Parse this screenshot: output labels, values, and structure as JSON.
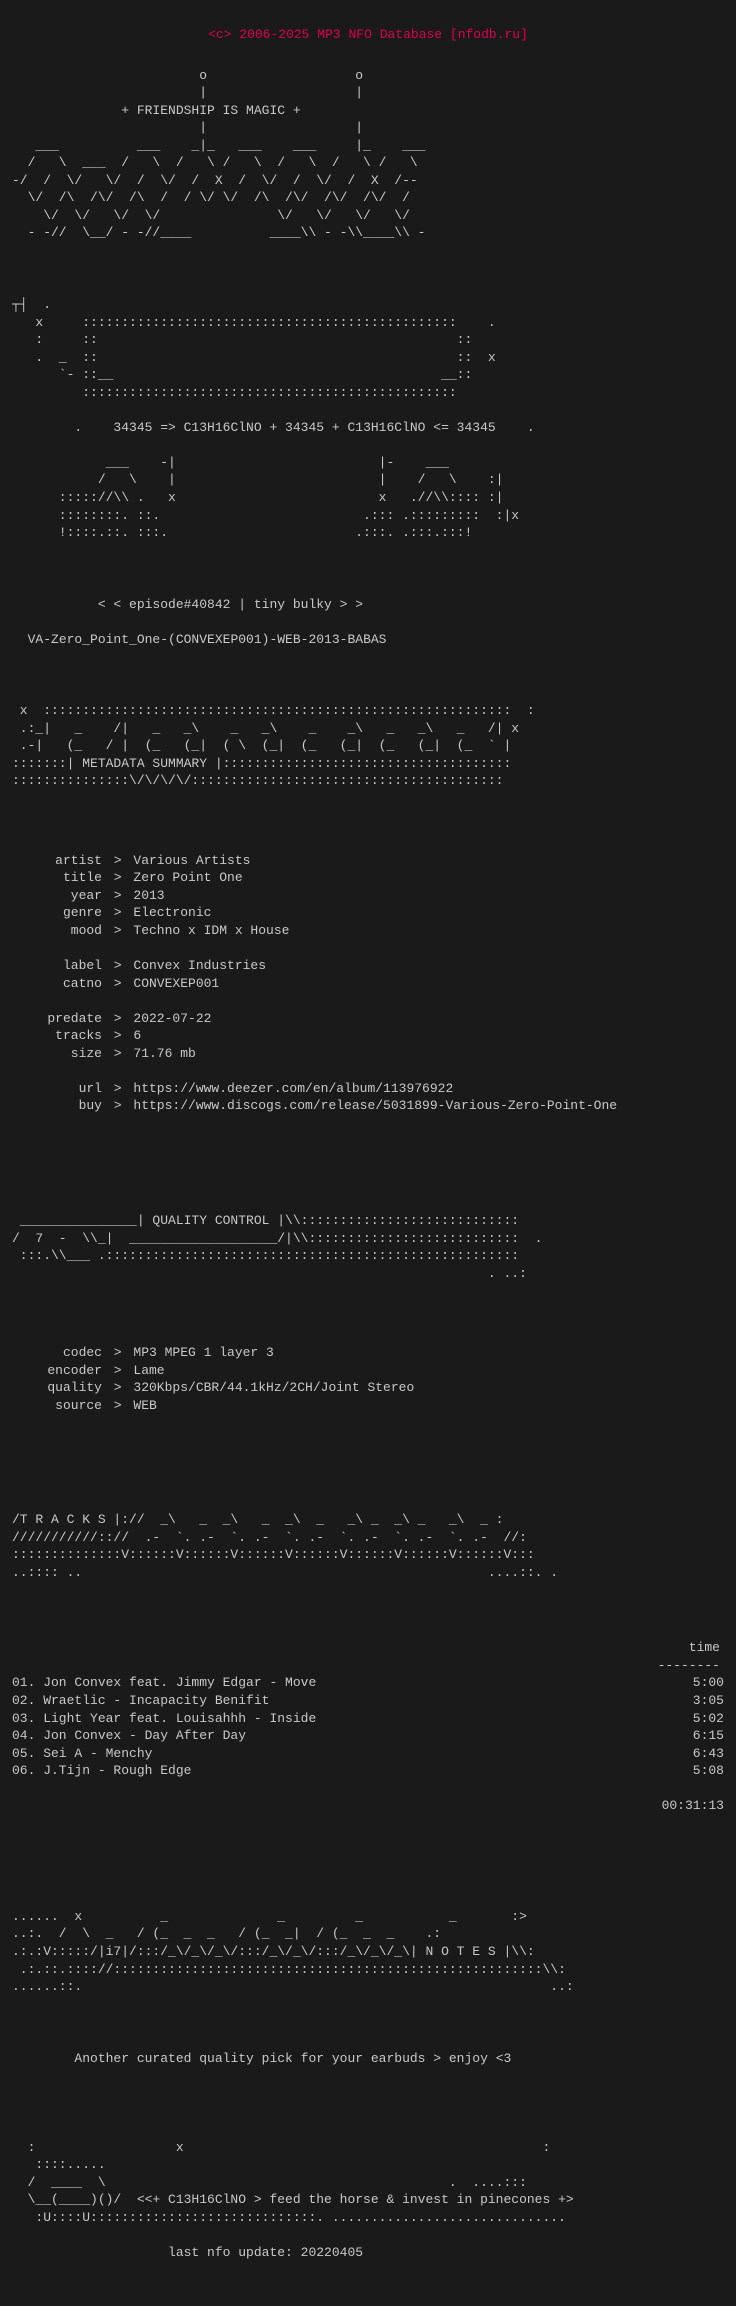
{
  "header": {
    "copyright": "<c> 2006-2025 MP3 NFO Database [nfodb.ru]"
  },
  "ascii_blocks": {
    "friendship": "+ FRIENDSHIP IS MAGIC +",
    "episode": "< episode#40842 | tiny bulky >",
    "release_name": "VA-Zero_Point_One-(CONVEXEP001)-WEB-2013-BABAS",
    "formula": "34345 => C13H16ClNO + 34345 + C13H16ClNO <= 34345"
  },
  "metadata": {
    "section_title": "METADATA SUMMARY",
    "artist": "Various Artists",
    "title": "Zero Point One",
    "year": "2013",
    "genre": "Electronic",
    "mood": "Techno x IDM x House",
    "label": "Convex Industries",
    "catno": "CONVEXEP001",
    "predate": "2022-07-22",
    "tracks": "6",
    "size": "71.76 mb",
    "url": "https://www.deezer.com/en/album/113976922",
    "buy": "https://www.discogs.com/release/5031899-Various-Zero-Point-One"
  },
  "quality": {
    "section_title": "QUALITY CONTROL",
    "codec": "MP3 MPEG 1 layer 3",
    "encoder": "Lame",
    "quality": "320Kbps/CBR/44.1kHz/2CH/Joint Stereo",
    "source": "WEB"
  },
  "tracks": {
    "section_title": "T R A C K S",
    "time_header": "time",
    "separator": "--------",
    "list": [
      {
        "number": "01.",
        "name": "Jon Convex feat. Jimmy Edgar - Move",
        "time": "5:00"
      },
      {
        "number": "02.",
        "name": "Wraetlic - Incapacity Benifit",
        "time": "3:05"
      },
      {
        "number": "03.",
        "name": "Light Year feat. Louisahhh - Inside",
        "time": "5:02"
      },
      {
        "number": "04.",
        "name": "Jon Convex - Day After Day",
        "time": "6:15"
      },
      {
        "number": "05.",
        "name": "Sei A - Menchy",
        "time": "6:43"
      },
      {
        "number": "06.",
        "name": "J.Tijn - Rough Edge",
        "time": "5:08"
      }
    ],
    "total": "00:31:13"
  },
  "notes": {
    "section_title": "N O T E S",
    "text": "Another curated quality pick for your earbuds > enjoy <3"
  },
  "footer": {
    "tagline": "<+ C13H16ClNO > feed the horse & invest in pinecones +>",
    "last_update": "last nfo update: 20220405"
  }
}
